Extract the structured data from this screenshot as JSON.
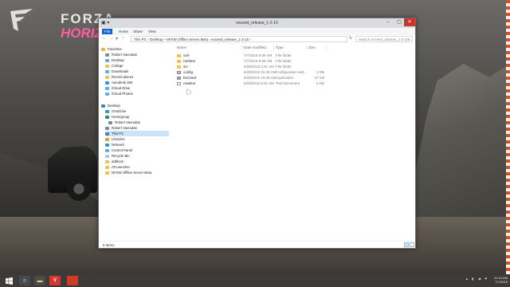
{
  "background": {
    "logo_text": "FORZA",
    "logo_sub": "HORIZ"
  },
  "window": {
    "title": "exceed_release_1-2-10",
    "ribbon_tabs": [
      "File",
      "Home",
      "Share",
      "View"
    ],
    "address_path": "This PC  ›  Desktop  ›  NFSW Offline Server Beta  ›  exceed_release_1-2-10  ›",
    "search_placeholder": "Search exceed_release_1-2-10",
    "columns": {
      "name": "Name",
      "date": "Date modified",
      "type": "Type",
      "size": "Size"
    },
    "files": [
      {
        "name": "cert",
        "date": "7/7/2015 9:56 AM",
        "type": "File folder",
        "size": "",
        "icon": "folder-icon"
      },
      {
        "name": "runtime",
        "date": "7/7/2015 9:56 AM",
        "type": "File folder",
        "size": "",
        "icon": "folder-icon"
      },
      {
        "name": "src",
        "date": "6/28/2015 3:31 AM",
        "type": "File folder",
        "size": "",
        "icon": "folder-icon"
      },
      {
        "name": "config",
        "date": "6/28/2015 10:49 AM",
        "type": "Configuration sett...",
        "size": "1 KB",
        "icon": "config-icon"
      },
      {
        "name": "ExCeed",
        "date": "6/28/2015 10:36 AM",
        "type": "Application",
        "size": "57 KB",
        "icon": "app-icon"
      },
      {
        "name": "readme",
        "date": "6/28/2015 9:31 AM",
        "type": "Text Document",
        "size": "5 KB",
        "icon": "text-icon"
      }
    ],
    "status_count": "6 items"
  },
  "nav_pane": {
    "favorites_label": "Favorites",
    "favorites": [
      "Robert Vavrudas",
      "Desktop",
      "College",
      "Downloads",
      "Recent places",
      "Autodesk 360",
      "iCloud Drive",
      "iCloud Photos"
    ],
    "desktop_label": "Desktop",
    "desktop_items": [
      "OneDrive",
      "Homegroup",
      "Robert Vavrudas",
      "Robert Vavrudas",
      "This PC",
      "Libraries",
      "Network",
      "Control Panel",
      "Recycle Bin",
      "adblock",
      "ATLauncher",
      "NFSW Offline Server Beta"
    ]
  },
  "taskbar": {
    "clock_time": "10:15 AM",
    "clock_date": "7/7/2015",
    "vivaldi_label": "V"
  },
  "colors": {
    "close_button": "#c7352b",
    "file_tab": "#1a63c7",
    "selected_tree_item": "#cce4f7"
  }
}
